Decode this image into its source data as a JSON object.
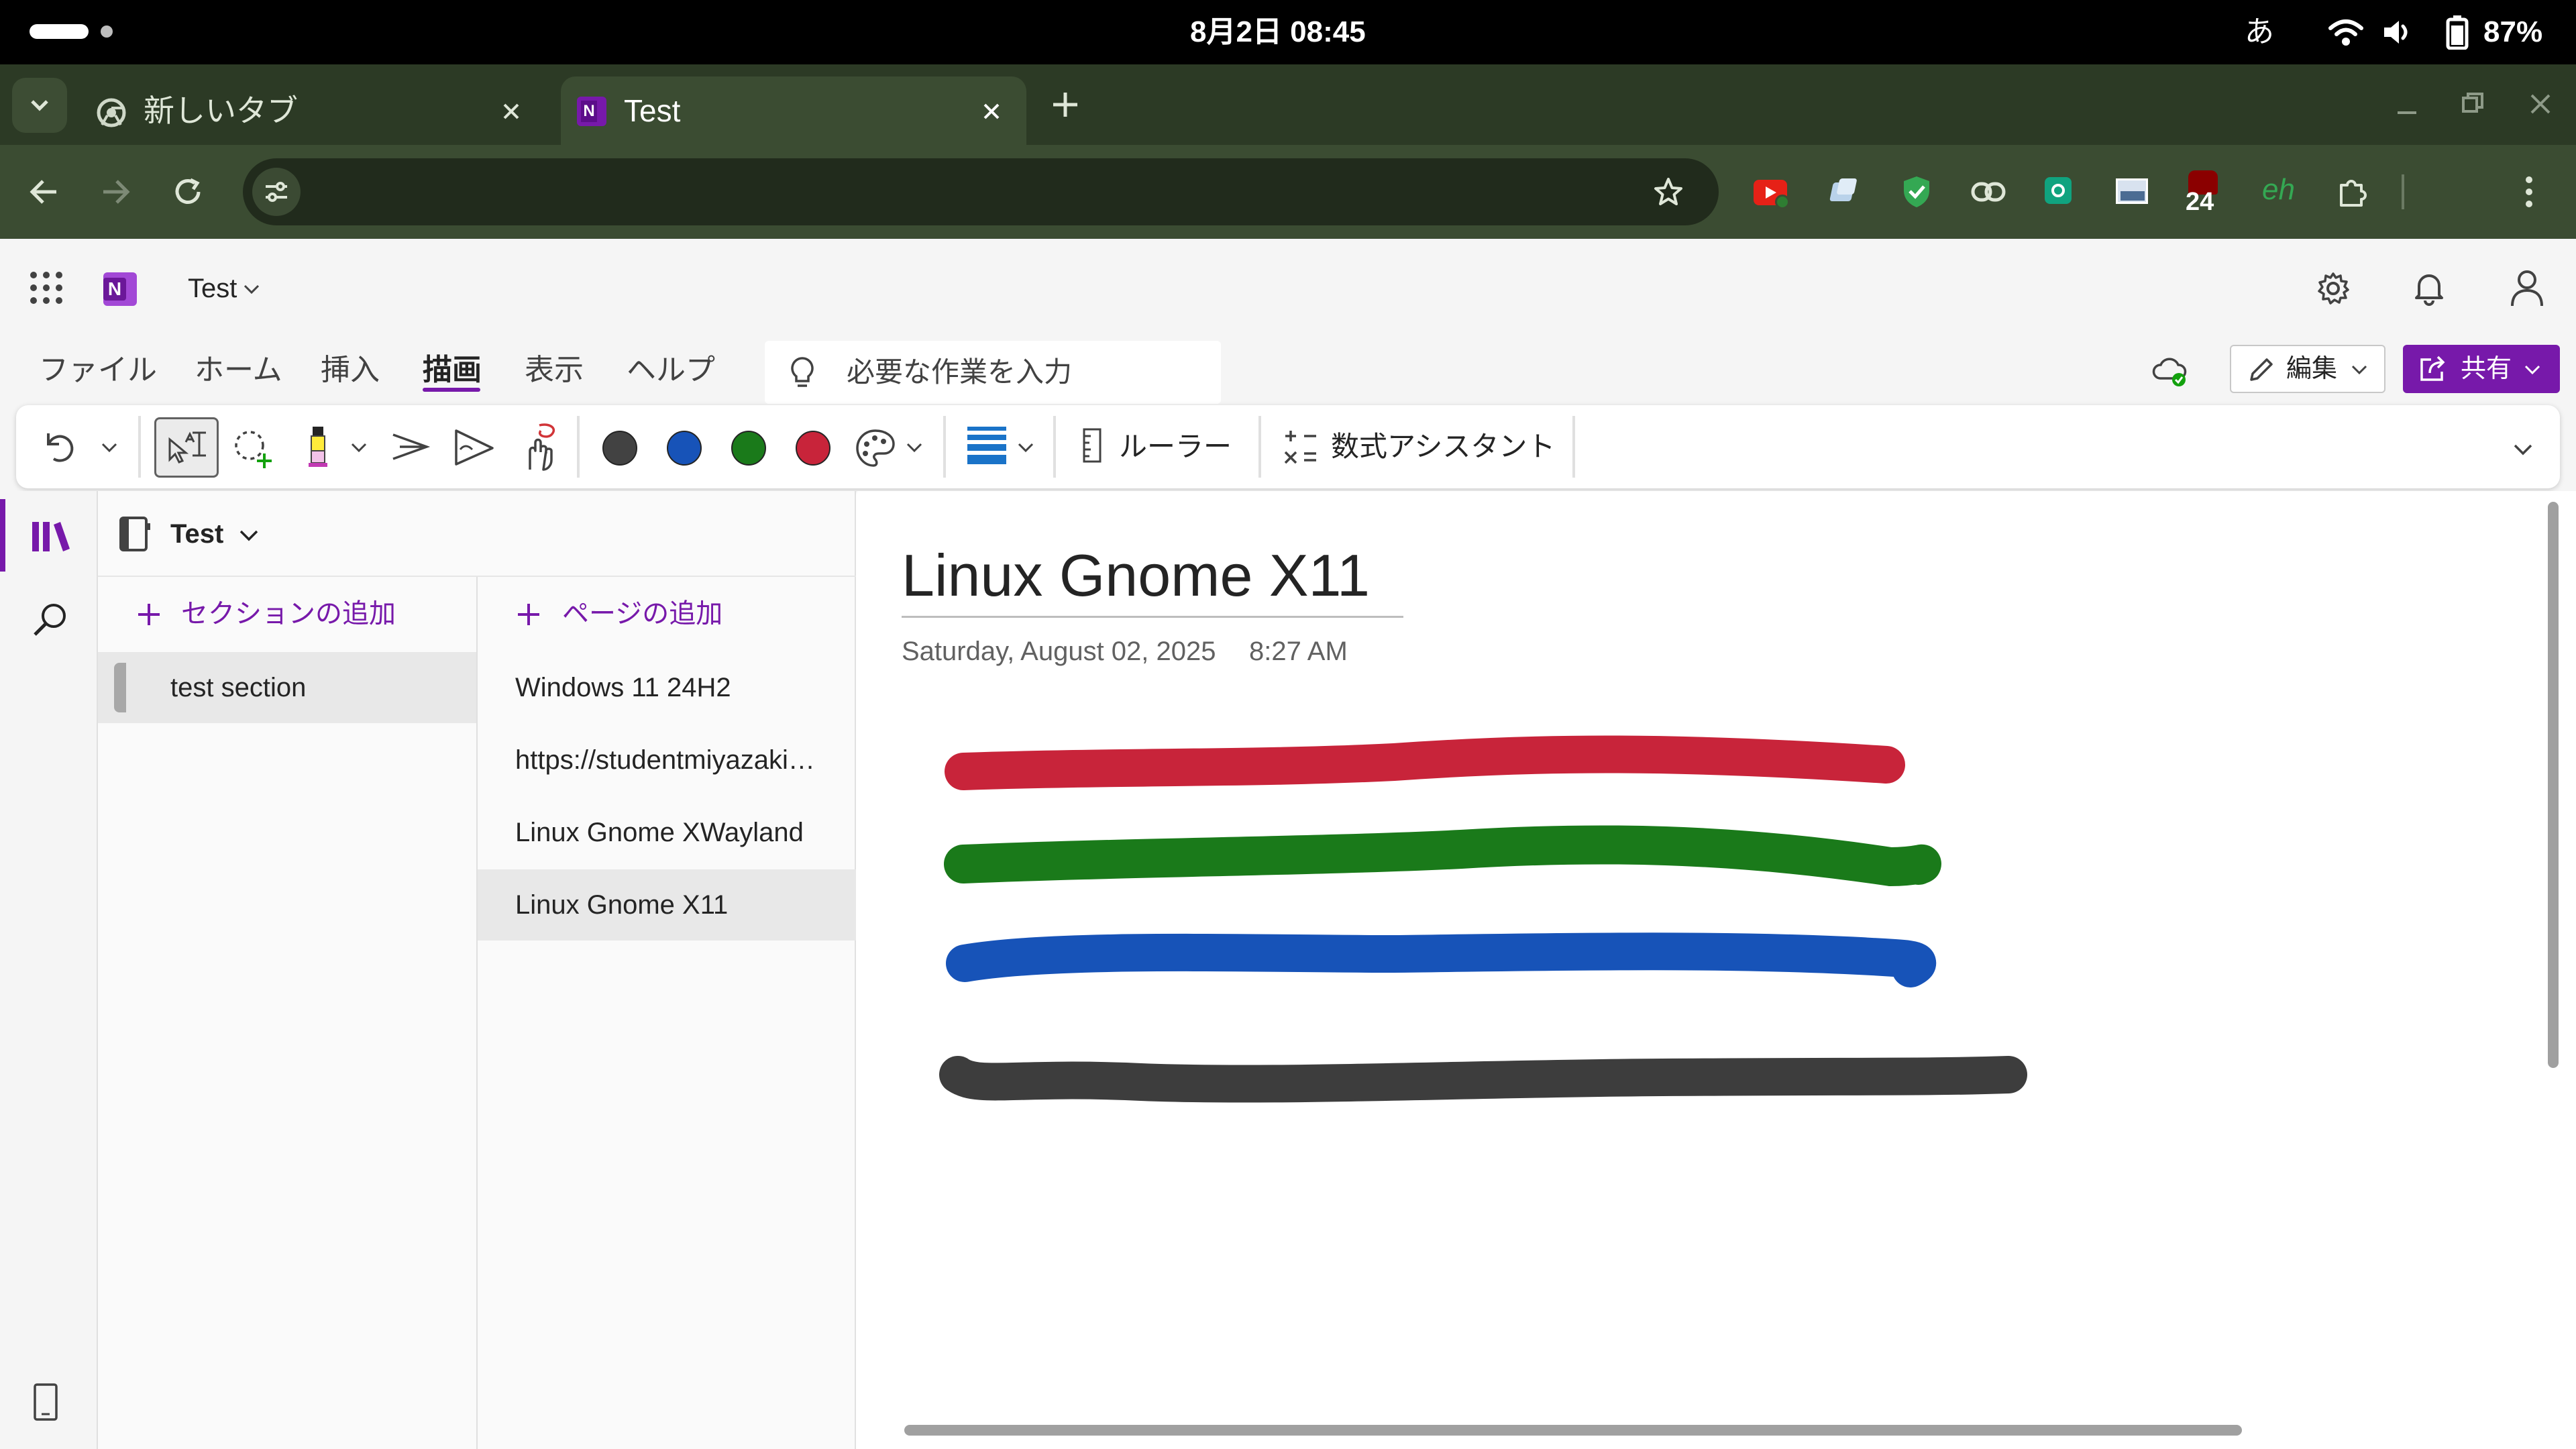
{
  "status_bar": {
    "datetime": "8月2日 08:45",
    "ime": "あ",
    "battery": "87%"
  },
  "browser": {
    "tabs": [
      {
        "title": "新しいタブ",
        "icon": "chrome-icon",
        "active": false
      },
      {
        "title": "Test",
        "icon": "onenote-icon",
        "active": true
      }
    ],
    "extension_badge": "24",
    "extension_eh": "eh"
  },
  "app": {
    "notebook_title": "Test",
    "ribbon_tabs": [
      "ファイル",
      "ホーム",
      "挿入",
      "描画",
      "表示",
      "ヘルプ"
    ],
    "active_tab": "描画",
    "search_placeholder": "必要な作業を入力",
    "edit_label": "編集",
    "share_label": "共有",
    "ribbon": {
      "ruler_label": "ルーラー",
      "math_label": "数式アシスタント",
      "pen_colors": [
        "#424242",
        "#1753b8",
        "#1a7a1a",
        "#c8243a"
      ]
    },
    "nav": {
      "notebook": "Test",
      "add_section": "セクションの追加",
      "add_page": "ページの追加",
      "sections": [
        {
          "name": "test section",
          "selected": true
        }
      ],
      "pages": [
        {
          "name": "Windows 11 24H2",
          "selected": false
        },
        {
          "name": "https://studentmiyazaki…",
          "selected": false
        },
        {
          "name": "Linux Gnome XWayland",
          "selected": false
        },
        {
          "name": "Linux Gnome X11",
          "selected": true
        }
      ]
    },
    "page": {
      "title": "Linux Gnome X11",
      "date": "Saturday, August 02, 2025",
      "time": "8:27 AM",
      "ink_colors": [
        "#c8243a",
        "#1a7a1a",
        "#1753b8",
        "#3d3d3d"
      ]
    }
  }
}
